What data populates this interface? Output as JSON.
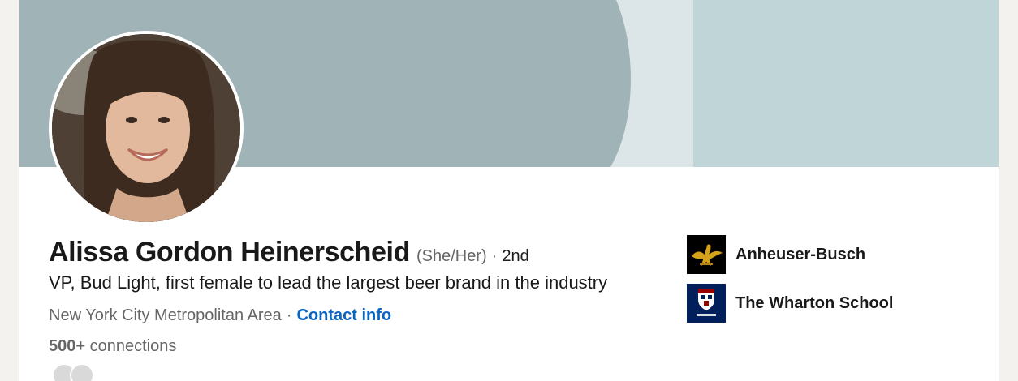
{
  "profile": {
    "name": "Alissa Gordon Heinerscheid",
    "pronouns": "(She/Her)",
    "degree_separator": "·",
    "degree": "2nd",
    "headline": "VP, Bud Light, first female to lead the largest beer brand in the industry",
    "location": "New York City Metropolitan Area",
    "location_separator": "·",
    "contact_info_label": "Contact info",
    "connections_count": "500+",
    "connections_label": "connections"
  },
  "organizations": [
    {
      "name": "Anheuser-Busch",
      "logo_icon": "anheuser-busch-eagle-logo"
    },
    {
      "name": "The Wharton School",
      "logo_icon": "wharton-shield-logo"
    }
  ],
  "colors": {
    "banner_dark": "#a0b4b7",
    "banner_light": "#dce6e8",
    "banner_right": "#c0d5d8",
    "link_blue": "#0a66c2",
    "wharton_navy": "#011f5b"
  }
}
